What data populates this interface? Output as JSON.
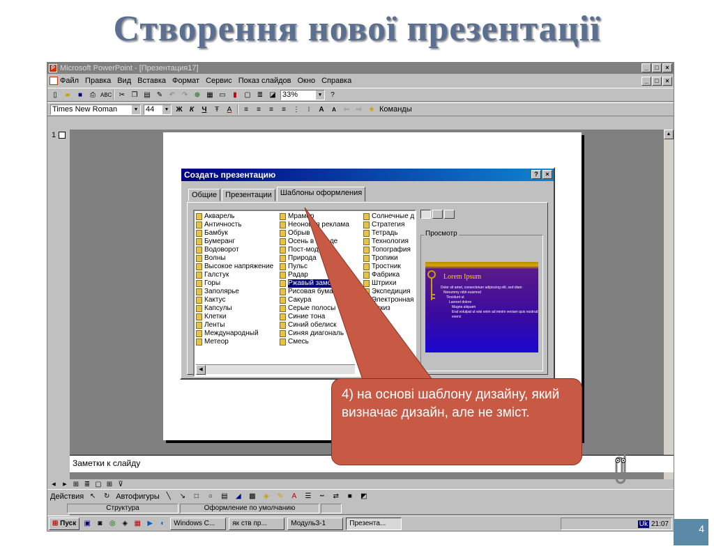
{
  "slide_title": "Створення нової презентації",
  "window": {
    "title": "Microsoft PowerPoint - [Презентация17]",
    "min": "_",
    "max": "□",
    "close": "×"
  },
  "menu": [
    "Файл",
    "Правка",
    "Вид",
    "Вставка",
    "Формат",
    "Сервис",
    "Показ слайдов",
    "Окно",
    "Справка"
  ],
  "toolbar": {
    "zoom": "33%",
    "help": "?"
  },
  "format_toolbar": {
    "font": "Times New Roman",
    "size": "44",
    "bold": "Ж",
    "italic": "К",
    "underline": "Ч",
    "commands": "Команды"
  },
  "workspace": {
    "slide_number": "1"
  },
  "dialog": {
    "title": "Создать презентацию",
    "help": "?",
    "close": "×",
    "tabs": [
      "Общие",
      "Презентации",
      "Шаблоны оформления"
    ],
    "col1": [
      "Акварель",
      "Античность",
      "Бамбук",
      "Бумеранг",
      "Водоворот",
      "Волны",
      "Высокое напряжение",
      "Галстук",
      "Горы",
      "Заполярье",
      "Кактус",
      "Капсулы",
      "Клетки",
      "Ленты",
      "Международный",
      "Метеор"
    ],
    "col2": [
      "Мрамор",
      "Неоновая реклама",
      "Обрыв",
      "Осень в городе",
      "Пост-модерн",
      "Природа",
      "Пульс",
      "Радар",
      "Ржавый замок",
      "Рисовая бумага",
      "Сакура",
      "Серые полосы",
      "Синие тона",
      "Синий обелиск",
      "Синяя диагональ",
      "Смесь"
    ],
    "col3": [
      "Солнечные д",
      "Стратегия",
      "Тетрадь",
      "Технология",
      "Топография",
      "Тропики",
      "Тростник",
      "Фабрика",
      "Штрихи",
      "Экспедиция",
      "Электронная",
      "Эскиз"
    ],
    "selected": "Ржавый замок",
    "preview_label": "Просмотр",
    "preview": {
      "title": "Lorem Ipsum",
      "b1": "Dolor sit amet, consectetuer adipiscing elit, sed diam",
      "b2": "Nonummy nibh euismod",
      "b3": "Tincidunt ut",
      "b4": "Laoreet dolore",
      "b5": "Magna aliquam",
      "b6": "Erat volutpat ut wisi enim ad minim veniam quis nostrud exerci"
    }
  },
  "notes": "Заметки к слайду",
  "drawbar": {
    "actions": "Действия",
    "autoshapes": "Автофигуры"
  },
  "status": {
    "structure": "Структура",
    "design": "Оформление по умолчанию"
  },
  "taskbar": {
    "start": "Пуск",
    "tasks": [
      "Windows C...",
      "як ств пр...",
      "Модуль3-1",
      "Презента..."
    ],
    "active_task": "Презента...",
    "tray_lang": "Uk",
    "time": "21:07"
  },
  "callout": "4) на основі шаблону дизайну, який визначає дизайн, але не зміст.",
  "page_number": "4"
}
